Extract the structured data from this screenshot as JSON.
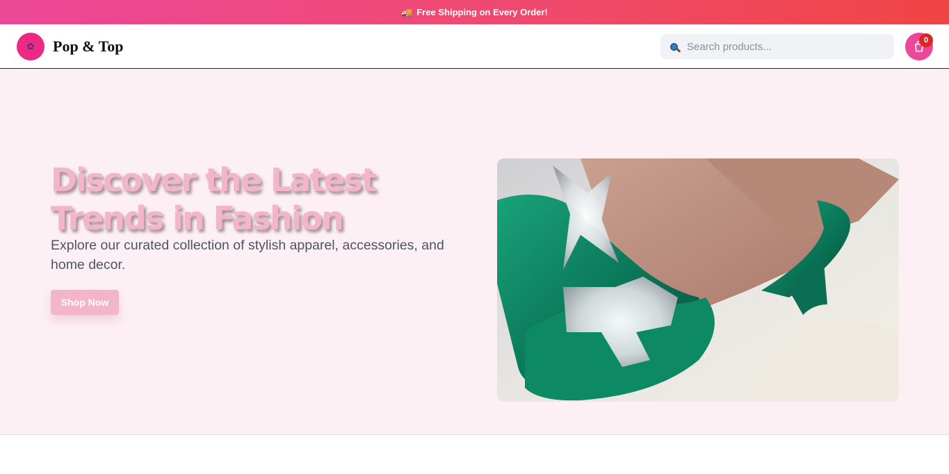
{
  "announcement": {
    "icon": "truck-icon",
    "text": "Free Shipping on Every Order!"
  },
  "header": {
    "brand": "Pop & Top",
    "logo_icon": "flower-icon",
    "search": {
      "placeholder": "Search products...",
      "value": ""
    },
    "cart": {
      "count": "0",
      "icon": "shopping-bag-icon"
    }
  },
  "hero": {
    "title": "Discover the Latest Trends in Fashion",
    "subtitle": "Explore our curated collection of stylish apparel, accessories, and home decor.",
    "cta_label": "Shop Now",
    "image_alt": "green satin heel with crystal bow"
  },
  "colors": {
    "accent": "#ec4899",
    "hero_bg": "#fdf0f5",
    "badge": "#dc2626",
    "title": "#f2b6c8"
  }
}
